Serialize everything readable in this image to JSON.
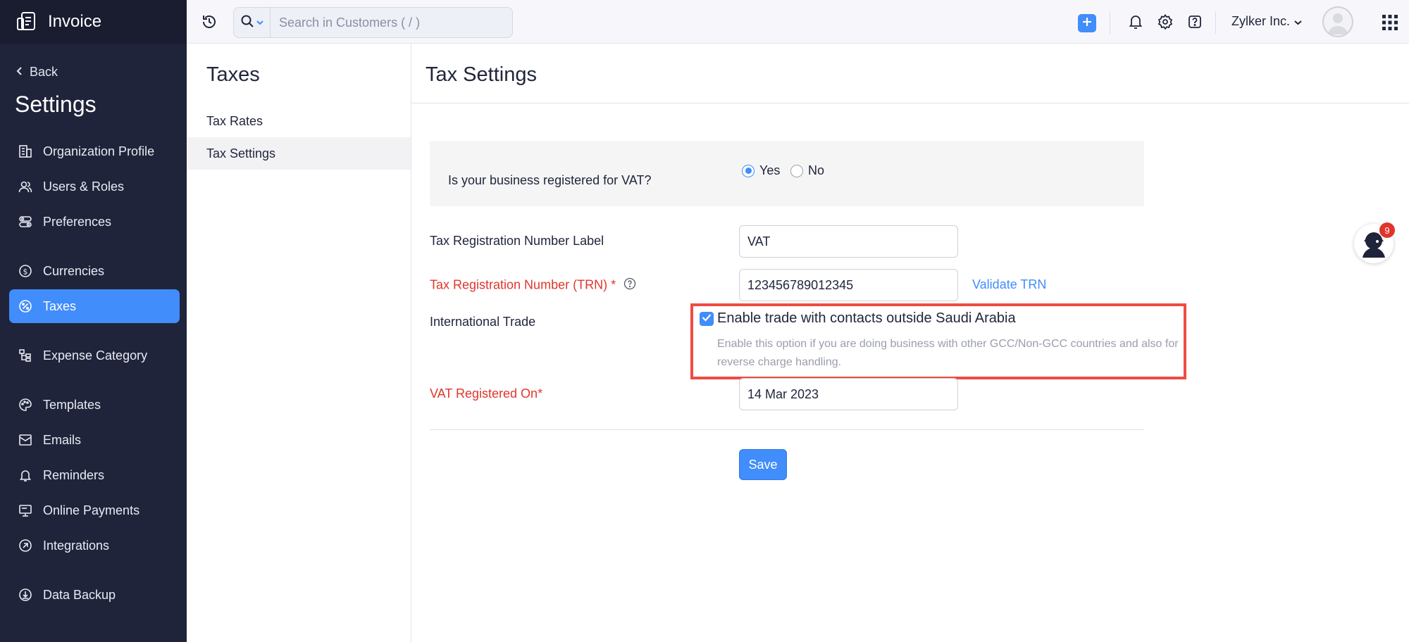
{
  "app": {
    "name": "Invoice"
  },
  "sidebar": {
    "back_label": "Back",
    "title": "Settings",
    "items": [
      {
        "label": "Organization Profile",
        "icon": "building-icon"
      },
      {
        "label": "Users & Roles",
        "icon": "users-icon"
      },
      {
        "label": "Preferences",
        "icon": "preferences-icon"
      },
      {
        "label": "Currencies",
        "icon": "currency-icon"
      },
      {
        "label": "Taxes",
        "icon": "tax-icon",
        "active": true
      },
      {
        "label": "Expense Category",
        "icon": "category-icon"
      },
      {
        "label": "Templates",
        "icon": "palette-icon"
      },
      {
        "label": "Emails",
        "icon": "email-icon"
      },
      {
        "label": "Reminders",
        "icon": "bell-icon"
      },
      {
        "label": "Online Payments",
        "icon": "payments-icon"
      },
      {
        "label": "Integrations",
        "icon": "integrations-icon"
      },
      {
        "label": "Data Backup",
        "icon": "backup-icon"
      }
    ]
  },
  "topbar": {
    "search_placeholder": "Search in Customers ( / )",
    "org_name": "Zylker Inc."
  },
  "subnav": {
    "title": "Taxes",
    "items": [
      {
        "label": "Tax Rates"
      },
      {
        "label": "Tax Settings",
        "active": true
      }
    ]
  },
  "main": {
    "title": "Tax Settings",
    "vat_question": "Is your business registered for VAT?",
    "vat_options": {
      "yes": "Yes",
      "no": "No",
      "selected": "Yes"
    },
    "trn_label_label": "Tax Registration Number Label",
    "trn_label_value": "VAT",
    "trn_label": "Tax Registration Number (TRN) *",
    "trn_value": "123456789012345",
    "validate_label": "Validate TRN",
    "intl_trade_label": "International Trade",
    "intl_trade_checkbox": "Enable trade with contacts outside Saudi Arabia",
    "intl_trade_checked": true,
    "intl_trade_help": "Enable this option if you are doing business with other GCC/Non-GCC countries and also for reverse charge handling.",
    "vat_registered_label": "VAT Registered On*",
    "vat_registered_value": "14 Mar 2023",
    "save_label": "Save"
  },
  "helper": {
    "badge_count": "9"
  },
  "colors": {
    "accent": "#408dfb",
    "sidebar": "#20243a",
    "required": "#e0352b",
    "highlight": "#ee4c43"
  }
}
